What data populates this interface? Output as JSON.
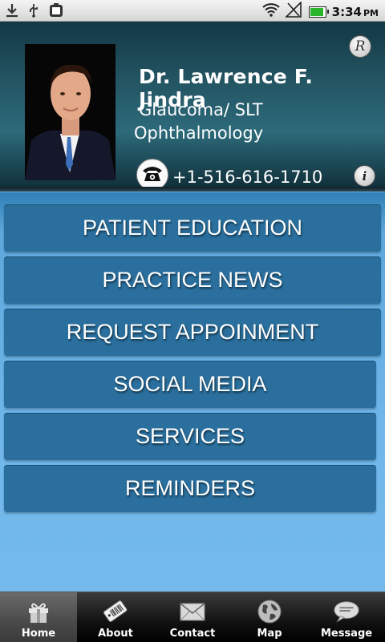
{
  "status_bar": {
    "time": "3:34",
    "ampm": "PM",
    "icons": [
      "download-icon",
      "usb-icon",
      "android-icon",
      "wifi-icon",
      "signal-icon",
      "battery-icon"
    ]
  },
  "profile": {
    "name": "Dr. Lawrence F. Jindra",
    "specialty": "Glaucoma/ SLT",
    "department": "Ophthalmology",
    "phone": "+1-516-616-1710",
    "r_button_glyph": "R",
    "info_button_glyph": "i"
  },
  "menu": {
    "items": [
      {
        "label": "PATIENT EDUCATION"
      },
      {
        "label": "PRACTICE NEWS"
      },
      {
        "label": "REQUEST APPOINMENT"
      },
      {
        "label": "SOCIAL MEDIA"
      },
      {
        "label": "SERVICES"
      },
      {
        "label": "REMINDERS"
      }
    ]
  },
  "tabs": [
    {
      "label": "Home",
      "icon": "gift-icon",
      "active": true
    },
    {
      "label": "About",
      "icon": "barcode-tag-icon",
      "active": false
    },
    {
      "label": "Contact",
      "icon": "envelope-icon",
      "active": false
    },
    {
      "label": "Map",
      "icon": "globe-icon",
      "active": false
    },
    {
      "label": "Message",
      "icon": "chat-bubble-icon",
      "active": false
    }
  ],
  "colors": {
    "header_dark": "#123844",
    "menu_button": "#2a6f9d",
    "menu_background": "#6fb6ea",
    "tabbar": "#111111"
  }
}
